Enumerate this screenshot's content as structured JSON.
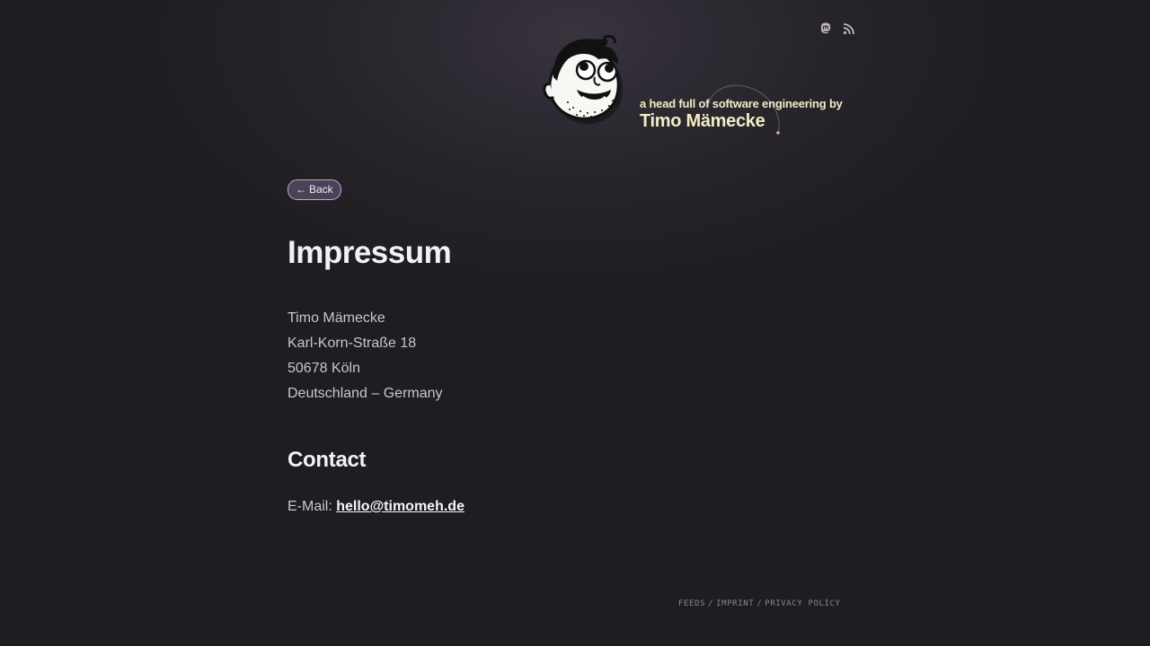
{
  "header": {
    "icons": [
      {
        "name": "mastodon-icon",
        "color": "#bdb8c2"
      },
      {
        "name": "rss-icon",
        "color": "#bdb8c2"
      }
    ],
    "tagline": "a head full of software engineering by",
    "author_name": "Timo Mämecke",
    "tagline_color": "#f3ecc4"
  },
  "nav": {
    "back_arrow": "←",
    "back_label": "Back"
  },
  "main": {
    "title": "Impressum",
    "address_lines": [
      "Timo Mämecke",
      "Karl-Korn-Straße 18",
      "50678 Köln",
      "Deutschland – Germany"
    ],
    "contact_heading": "Contact",
    "email_label": "E-Mail:",
    "email": "hello@timomeh.de"
  },
  "footer": {
    "links": [
      "FEEDS",
      "IMPRINT",
      "PRIVACY POLICY"
    ],
    "separator": "/"
  }
}
